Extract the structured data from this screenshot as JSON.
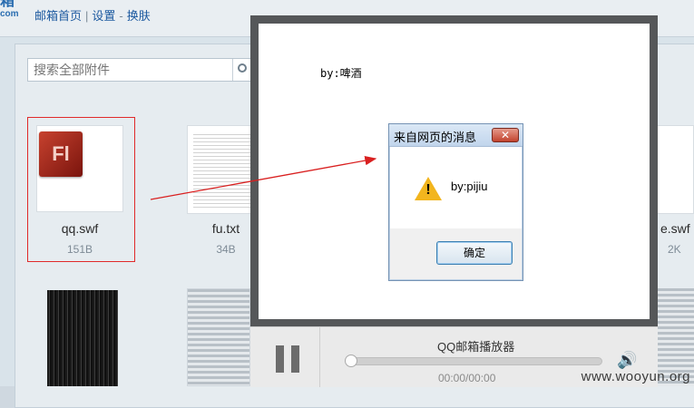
{
  "header": {
    "logo_line1": "箱",
    "logo_line2": "com",
    "links": [
      "邮箱首页",
      "设置",
      "换肤"
    ],
    "separator": "|",
    "dash": "-"
  },
  "search": {
    "placeholder": "搜索全部附件"
  },
  "files": [
    {
      "name": "qq.swf",
      "size": "151B",
      "icon": "flash-icon",
      "icon_text": "Fl"
    },
    {
      "name": "fu.txt",
      "size": "34B",
      "icon": "text-document-icon"
    },
    {
      "name": "e.swf",
      "size": "2K",
      "icon": "flash-icon"
    }
  ],
  "stage": {
    "caption": "by:啤酒"
  },
  "dialog": {
    "title": "来自网页的消息",
    "message": "by:pijiu",
    "ok_label": "确定",
    "close_label": "✕"
  },
  "player": {
    "title": "QQ邮箱播放器",
    "time": "00:00/00:00",
    "progress": 0,
    "volume_icon": "speaker-icon"
  },
  "watermark": "www.wooyun.org",
  "colors": {
    "accent_red": "#e02a2a",
    "link_blue": "#1d5aa0",
    "warning_yellow": "#f2b51e"
  }
}
